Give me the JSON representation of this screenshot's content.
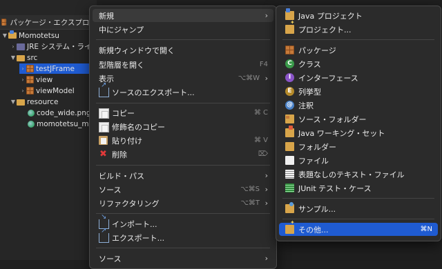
{
  "explorer": {
    "tab_title": "パッケージ・エクスプロー",
    "tree": [
      {
        "label": "Momotetsu",
        "icon": "java-project-icon",
        "expanded": true
      },
      {
        "label": "JRE システム・ライ",
        "icon": "jre-library-icon",
        "expanded": false
      },
      {
        "label": "src",
        "icon": "source-folder-icon",
        "expanded": true
      },
      {
        "label": "testJFrame",
        "icon": "package-icon",
        "expanded": false,
        "selected": true
      },
      {
        "label": "view",
        "icon": "package-icon",
        "expanded": false
      },
      {
        "label": "viewModel",
        "icon": "package-icon",
        "expanded": false
      },
      {
        "label": "resource",
        "icon": "folder-icon",
        "expanded": true
      },
      {
        "label": "code_wide.png",
        "icon": "image-file-icon"
      },
      {
        "label": "momotetsu_m",
        "icon": "image-file-icon"
      }
    ]
  },
  "context_menu": {
    "items": [
      {
        "label": "新規",
        "submenu": true,
        "highlighted": true
      },
      {
        "label": "中にジャンプ"
      },
      {
        "label": "新規ウィンドウで開く"
      },
      {
        "label": "型階層を開く",
        "shortcut": "F4"
      },
      {
        "label": "表示",
        "shortcut": "⌥⌘W",
        "submenu": true
      },
      {
        "label": "ソースのエクスポート...",
        "icon": "export-source-icon"
      },
      {
        "label": "コピー",
        "shortcut": "⌘ C",
        "icon": "copy-icon"
      },
      {
        "label": "修飾名のコピー",
        "icon": "copy-qualified-icon"
      },
      {
        "label": "貼り付け",
        "shortcut": "⌘ V",
        "icon": "paste-icon"
      },
      {
        "label": "削除",
        "shortcut": "⌦",
        "icon": "delete-icon"
      },
      {
        "label": "ビルド・パス",
        "submenu": true
      },
      {
        "label": "ソース",
        "shortcut": "⌥⌘S",
        "submenu": true
      },
      {
        "label": "リファクタリング",
        "shortcut": "⌥⌘T",
        "submenu": true
      },
      {
        "label": "インポート...",
        "icon": "import-icon"
      },
      {
        "label": "エクスポート...",
        "icon": "export-icon"
      },
      {
        "label": "ソース",
        "submenu": true
      }
    ]
  },
  "new_submenu": {
    "items": [
      {
        "label": "Java プロジェクト",
        "icon": "java-project-icon"
      },
      {
        "label": "プロジェクト...",
        "icon": "project-icon"
      },
      {
        "label": "パッケージ",
        "icon": "package-icon"
      },
      {
        "label": "クラス",
        "icon": "class-icon",
        "glyph": "C"
      },
      {
        "label": "インターフェース",
        "icon": "interface-icon",
        "glyph": "I"
      },
      {
        "label": "列挙型",
        "icon": "enum-icon",
        "glyph": "E"
      },
      {
        "label": "注釈",
        "icon": "annotation-icon",
        "glyph": "@"
      },
      {
        "label": "ソース・フォルダー",
        "icon": "source-folder-icon"
      },
      {
        "label": "Java ワーキング・セット",
        "icon": "working-set-icon"
      },
      {
        "label": "フォルダー",
        "icon": "folder-icon"
      },
      {
        "label": "ファイル",
        "icon": "file-icon"
      },
      {
        "label": "表題なしのテキスト・ファイル",
        "icon": "text-file-icon"
      },
      {
        "label": "JUnit テスト・ケース",
        "icon": "junit-icon"
      },
      {
        "label": "サンプル...",
        "icon": "sample-icon"
      },
      {
        "label": "その他...",
        "icon": "other-wizard-icon",
        "shortcut": "⌘N",
        "selected": true
      }
    ]
  },
  "colors": {
    "selection": "#1f5bd1",
    "menu_bg": "#2b2b2b",
    "highlight": "#3a3a3a"
  }
}
